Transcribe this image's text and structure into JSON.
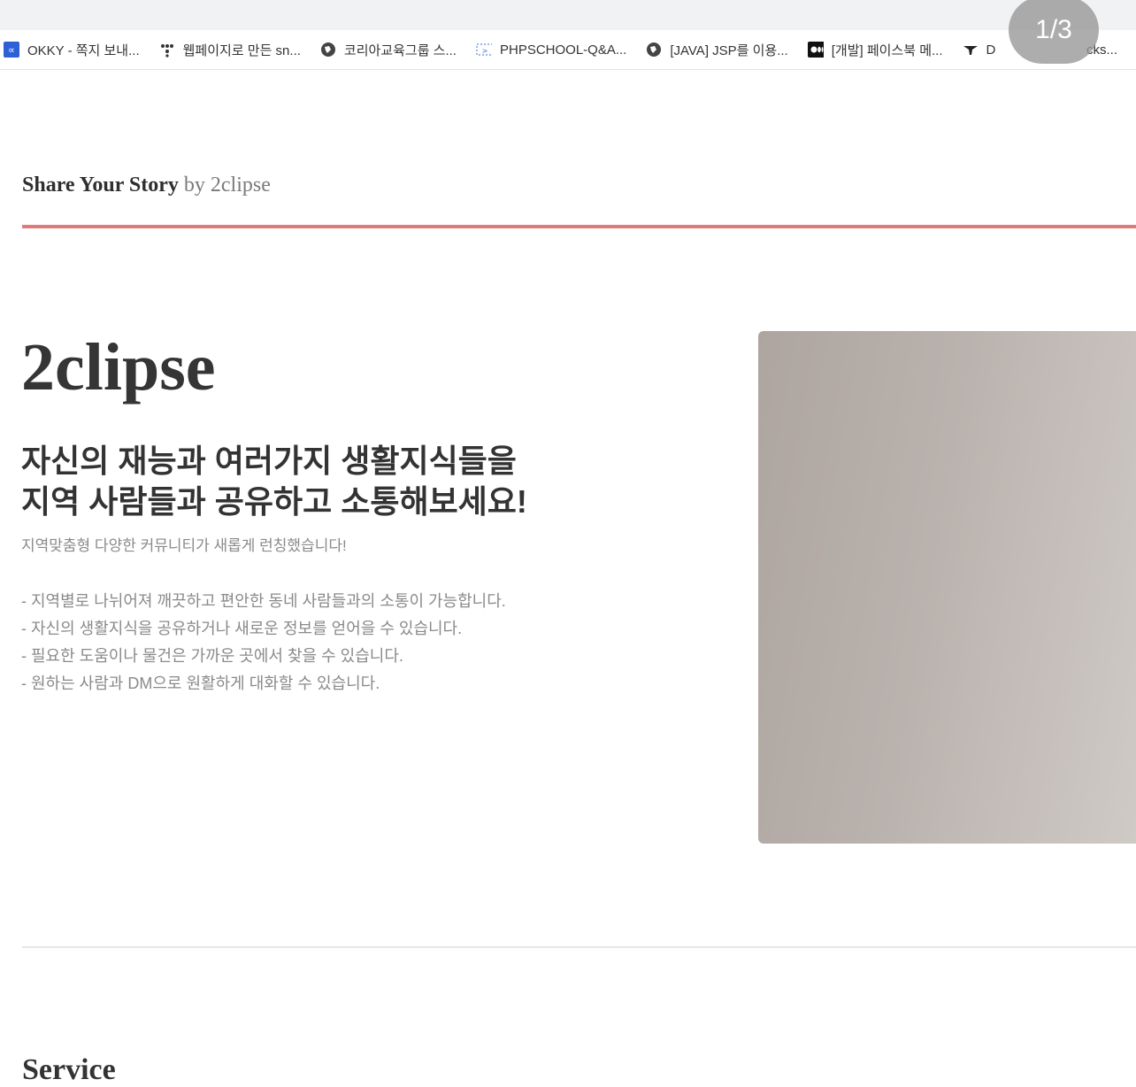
{
  "browser": {
    "page_counter": "1/3",
    "bookmarks": [
      {
        "icon": "okky-icon",
        "label": "OKKY - 쪽지 보내..."
      },
      {
        "icon": "dots-icon",
        "label": "웹페이지로 만든 sn..."
      },
      {
        "icon": "globe-icon",
        "label": "코리아교육그룹 스..."
      },
      {
        "icon": "php-icon",
        "label": "PHPSCHOOL-Q&A..."
      },
      {
        "icon": "globe-icon",
        "label": "[JAVA] JSP를 이용..."
      },
      {
        "icon": "medium-icon",
        "label": "[개발] 페이스북 메..."
      },
      {
        "icon": "dev-icon",
        "label": "D"
      },
      {
        "icon": "",
        "label": "cks..."
      }
    ]
  },
  "header": {
    "title_bold": "Share Your Story",
    "title_light": "by 2clipse",
    "accent_color": "#df7a7a"
  },
  "hero": {
    "title": "2clipse",
    "lead_line1": "자신의 재능과 여러가지 생활지식들을",
    "lead_line2": "지역 사람들과 공유하고 소통해보세요!",
    "subtitle": "지역맞춤형 다양한 커뮤니티가 새롭게 런칭했습니다!",
    "features": [
      "- 지역별로 나뉘어져 깨끗하고 편안한 동네 사람들과의 소통이 가능합니다.",
      "- 자신의 생활지식을 공유하거나 새로운 정보를 얻어을 수 있습니다.",
      "- 필요한 도움이나 물건은 가까운 곳에서 찾을 수 있습니다.",
      "- 원하는 사람과 DM으로 원활하게 대화할 수 있습니다."
    ]
  },
  "section": {
    "title": "Service"
  }
}
